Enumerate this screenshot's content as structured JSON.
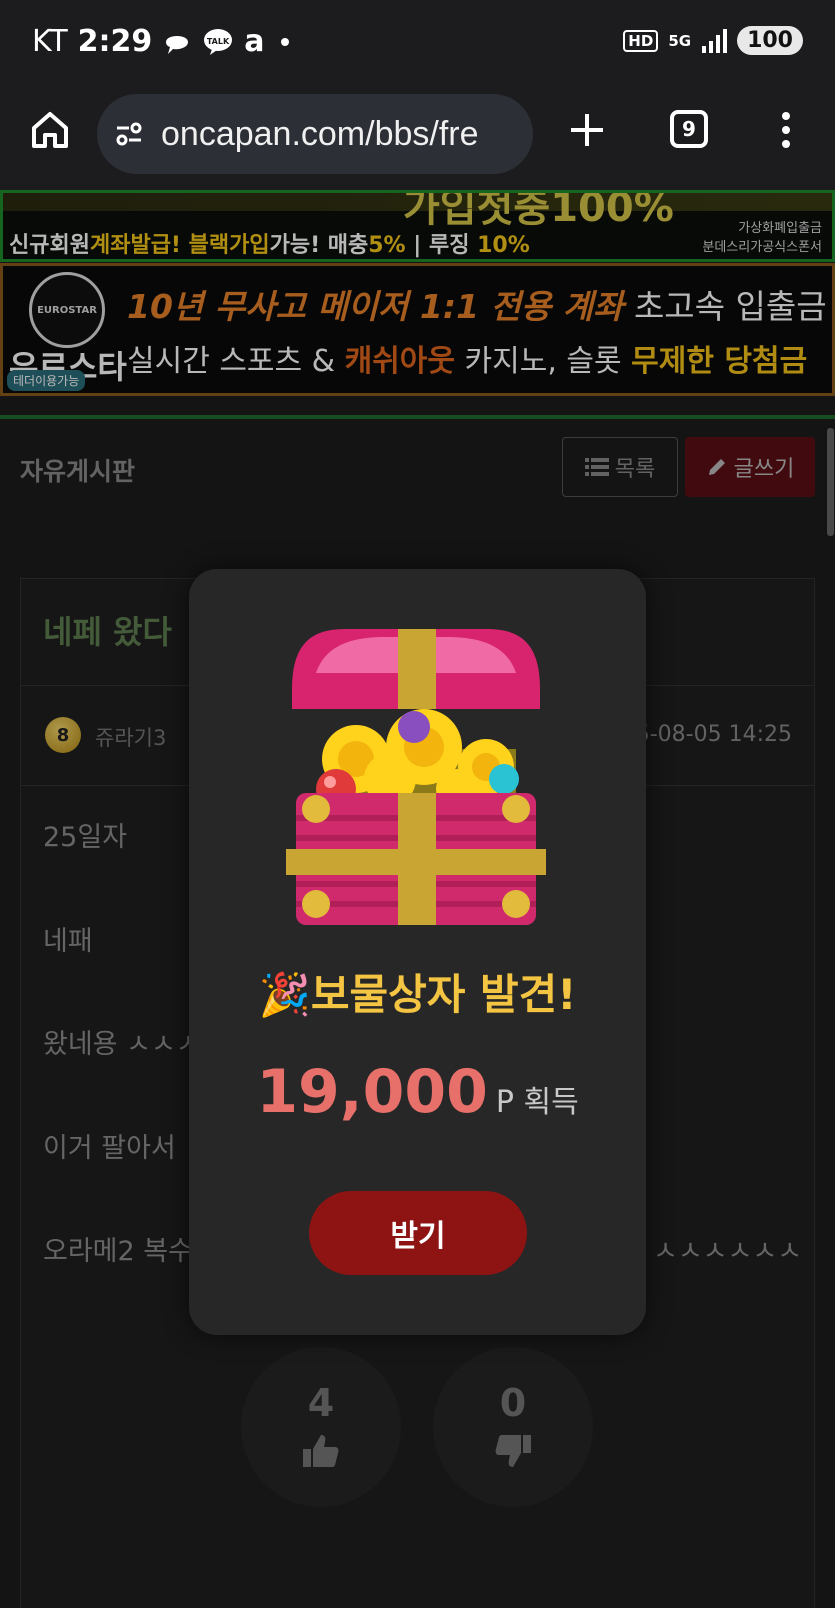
{
  "status_bar": {
    "carrier": "KT",
    "time": "2:29",
    "app_icon_a": "a",
    "hd": "HD",
    "network": "5G",
    "battery": "100"
  },
  "browser": {
    "url": "oncapan.com/bbs/fre",
    "tab_count": "9"
  },
  "banners": {
    "banner1_text_a": "신규회원",
    "banner1_text_b": "계좌발급! 블랙가입",
    "banner1_text_c": "가능! 매충",
    "banner1_text_d": "5%",
    "banner1_text_e": " | 루징 ",
    "banner1_text_f": "10%",
    "banner1_top": "가입첫충100%",
    "banner1_side1": "가상화폐입출금",
    "banner1_side2": "분데스리가공식스폰서",
    "banner2_logo": "EUROSTAR",
    "banner2_brand": "유로스타",
    "banner2_line1_a": "10년 무사고 메이저 1:1 전용 계좌",
    "banner2_line1_b": " 초고속 입출금",
    "banner2_line2_a": "실시간 스포츠 & ",
    "banner2_line2_b": "캐쉬아웃",
    "banner2_line2_c": " 카지노, 슬롯 ",
    "banner2_line2_d": "무제한 당첨금",
    "banner2_tag": "테더이용가능"
  },
  "board": {
    "title": "자유게시판",
    "list_button": "목록",
    "write_button": "글쓰기"
  },
  "post": {
    "title": "네페 왔다",
    "level": "8",
    "author": "쥬라기3",
    "date": "5-08-05 14:25",
    "lines": [
      "25일자",
      "네패",
      "왔네용 ㅅㅅㅅ",
      "이거 팔아서",
      "오라메2 복수"
    ],
    "line5_tail": "ㅅㅅㅅㅅㅅㅅ",
    "upvotes": "4",
    "downvotes": "0"
  },
  "modal": {
    "title": "🎉보물상자 발견!",
    "amount": "19,000",
    "unit": "P 획득",
    "claim_button": "받기"
  },
  "colors": {
    "modal_bg": "#272727",
    "title_gold": "#f4c542",
    "amount_red": "#e8706a",
    "claim_button": "#8e1414"
  }
}
